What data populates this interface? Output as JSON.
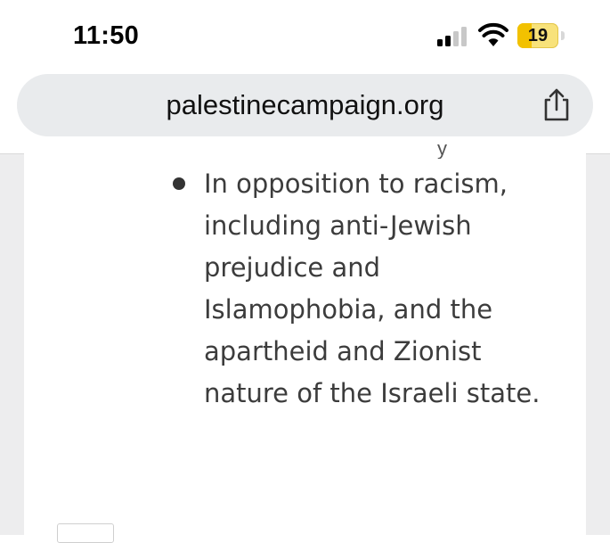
{
  "status_bar": {
    "time": "11:50",
    "battery_level": "19",
    "battery_color": "#f2c100",
    "signal_icon": "cellular-signal-icon",
    "wifi_icon": "wifi-icon"
  },
  "browser": {
    "url": "palestinecampaign.org",
    "share_icon": "share-icon"
  },
  "content": {
    "clipped_fragment": "y",
    "bullet_lines": [
      "In opposition to racism,",
      "including anti-Jewish",
      "prejudice and",
      "Islamophobia, and the",
      "apartheid and Zionist",
      "nature of the Israeli state."
    ]
  }
}
